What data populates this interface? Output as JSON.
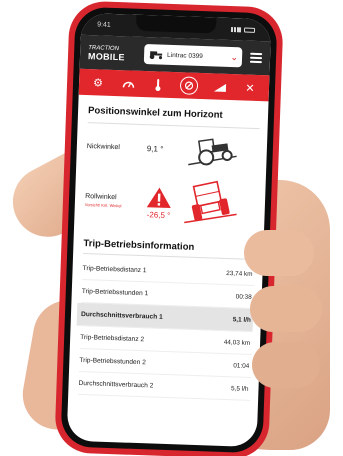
{
  "status": {
    "time": "9:41"
  },
  "header": {
    "logo_top": "TRACTION",
    "logo_bottom": "MOBILE",
    "selected_vehicle": "Lintrac 0399"
  },
  "toolbar": {
    "icons": [
      "gear-icon",
      "speedometer-icon",
      "thermometer-icon",
      "angle-gauge-icon",
      "slope-chart-icon",
      "fan-icon"
    ],
    "active_index": 3
  },
  "angles": {
    "title": "Positionswinkel zum Horizont",
    "pitch_label": "Nickwinkel",
    "pitch_value": "9,1 °",
    "roll_label": "Rollwinkel",
    "roll_sub": "Vorsicht! Krit. Winkel",
    "roll_value": "-26,5 °"
  },
  "trip": {
    "title": "Trip-Betriebsinformation",
    "rows": [
      {
        "label": "Trip-Betriebsdistanz 1",
        "value": "23,74 km"
      },
      {
        "label": "Trip-Betriebsstunden 1",
        "value": "00:38"
      },
      {
        "label": "Durchschnittsverbrauch 1",
        "value": "5,1 l/h"
      },
      {
        "label": "Trip-Betriebsdistanz 2",
        "value": "44,03 km"
      },
      {
        "label": "Trip-Betriebsstunden 2",
        "value": "01:04"
      },
      {
        "label": "Durchschnittsverbrauch 2",
        "value": "5,5 l/h"
      }
    ],
    "highlighted_index": 2
  },
  "colors": {
    "accent": "#e1262c",
    "header_bg": "#2a2a2a",
    "phone_frame": "#d7262e"
  }
}
